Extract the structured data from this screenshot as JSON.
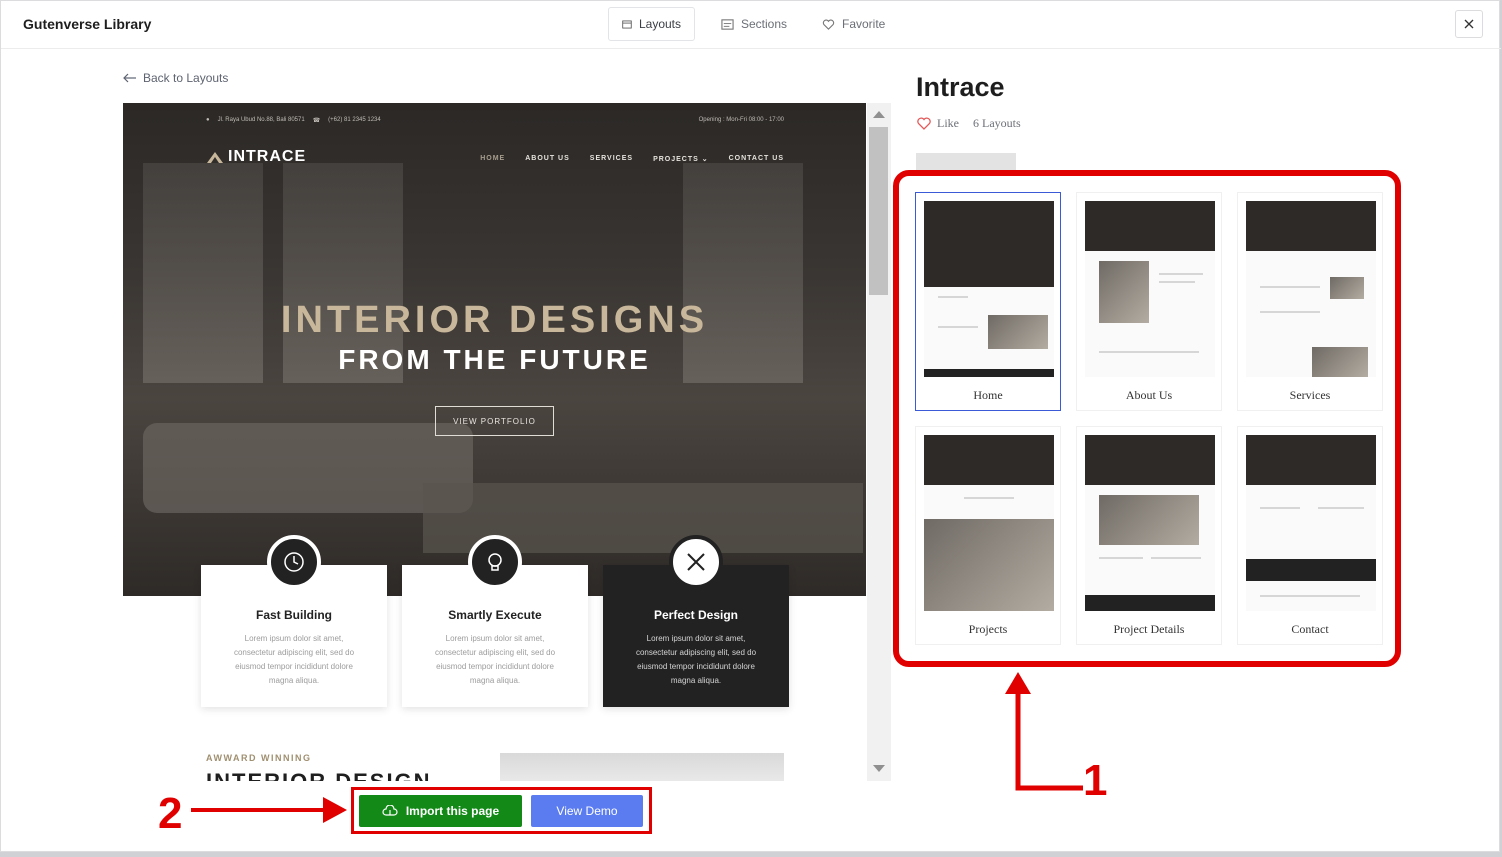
{
  "header": {
    "title": "Gutenverse Library",
    "tabs": [
      {
        "label": "Layouts",
        "icon": "layout-icon"
      },
      {
        "label": "Sections",
        "icon": "sections-icon"
      },
      {
        "label": "Favorite",
        "icon": "heart-icon"
      }
    ],
    "close_icon": "close-icon"
  },
  "back_link": "Back to Layouts",
  "preview": {
    "address": "Jl. Raya Ubud No.88, Bali 80571",
    "phone": "(+62) 81 2345 1234",
    "opening": "Opening : Mon-Fri 08:00 - 17:00",
    "logo": "INTRACE",
    "nav": [
      "HOME",
      "ABOUT US",
      "SERVICES",
      "PROJECTS",
      "CONTACT US"
    ],
    "hero_line1": "INTERIOR DESIGNS",
    "hero_line2": "FROM THE FUTURE",
    "hero_button": "VIEW PORTFOLIO",
    "features": [
      {
        "title": "Fast Building",
        "text": "Lorem ipsum dolor sit amet, consectetur adipiscing elit, sed do eiusmod tempor incididunt dolore magna aliqua."
      },
      {
        "title": "Smartly Execute",
        "text": "Lorem ipsum dolor sit amet, consectetur adipiscing elit, sed do eiusmod tempor incididunt dolore magna aliqua."
      },
      {
        "title": "Perfect Design",
        "text": "Lorem ipsum dolor sit amet, consectetur adipiscing elit, sed do eiusmod tempor incididunt dolore magna aliqua."
      }
    ],
    "award_label": "AWWARD WINNING",
    "award_heading": "INTERIOR DESIGN"
  },
  "actions": {
    "import_label": "Import this page",
    "demo_label": "View Demo"
  },
  "layout": {
    "title": "Intrace",
    "like_label": "Like",
    "count_label": "6 Layouts",
    "cards": [
      {
        "label": "Home"
      },
      {
        "label": "About Us"
      },
      {
        "label": "Services"
      },
      {
        "label": "Projects"
      },
      {
        "label": "Project Details"
      },
      {
        "label": "Contact"
      }
    ]
  },
  "annotations": {
    "one": "1",
    "two": "2"
  },
  "colors": {
    "highlight": "#e10000",
    "import_green": "#138a18",
    "demo_blue": "#5a7cf0",
    "active_card": "#3a5ad8"
  }
}
